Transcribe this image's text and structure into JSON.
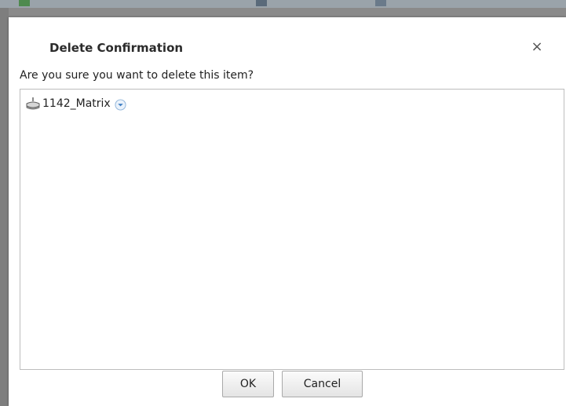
{
  "dialog": {
    "title": "Delete Confirmation",
    "close_glyph": "×",
    "prompt": "Are you sure you want to delete this item?",
    "items": [
      {
        "label": "1142_Matrix",
        "icon": "access-point-icon",
        "action_icon": "chevron-down-icon"
      }
    ],
    "ok_label": "OK",
    "cancel_label": "Cancel"
  },
  "colors": {
    "overlay": "#8a8a8a",
    "dialog_bg": "#ffffff",
    "list_border": "#bdbdbd",
    "dropdown_accent": "#4a90d9"
  }
}
